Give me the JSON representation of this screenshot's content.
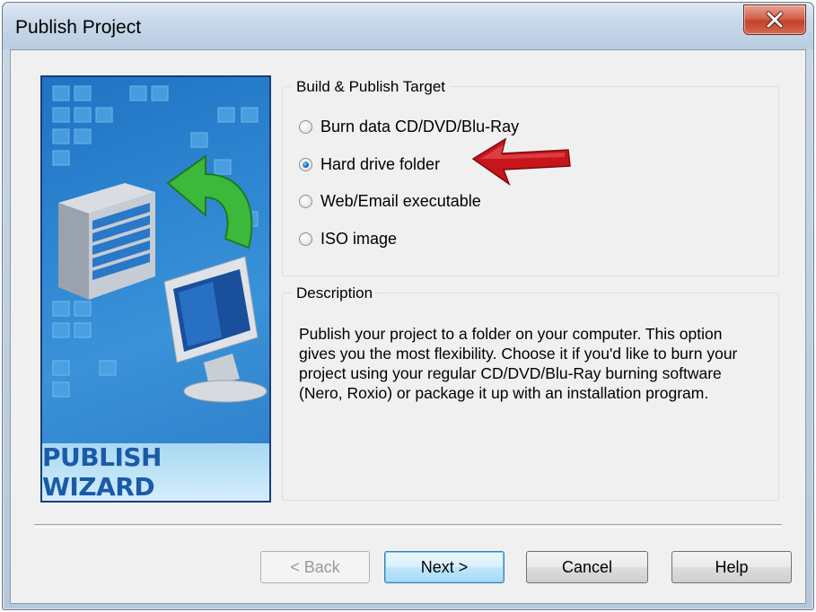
{
  "window": {
    "title": "Publish Project",
    "close_icon": "close-x-icon"
  },
  "wizard": {
    "label": "PUBLISH WIZARD",
    "graphic_icon": "server-to-computer-icon"
  },
  "target": {
    "legend": "Build & Publish Target",
    "options": [
      {
        "label": "Burn data CD/DVD/Blu-Ray",
        "checked": false
      },
      {
        "label": "Hard drive folder",
        "checked": true
      },
      {
        "label": "Web/Email executable",
        "checked": false
      },
      {
        "label": "ISO image",
        "checked": false
      }
    ]
  },
  "description": {
    "legend": "Description",
    "text": "Publish your project to a folder on your computer. This option gives you the most flexibility. Choose it if you'd like to burn your project using your regular CD/DVD/Blu-Ray burning software (Nero, Roxio) or package it up with an installation program."
  },
  "annotation": {
    "arrow_icon": "red-arrow-icon",
    "arrow_color": "#c8141b"
  },
  "buttons": {
    "back": "< Back",
    "next": "Next >",
    "cancel": "Cancel",
    "help": "Help"
  }
}
